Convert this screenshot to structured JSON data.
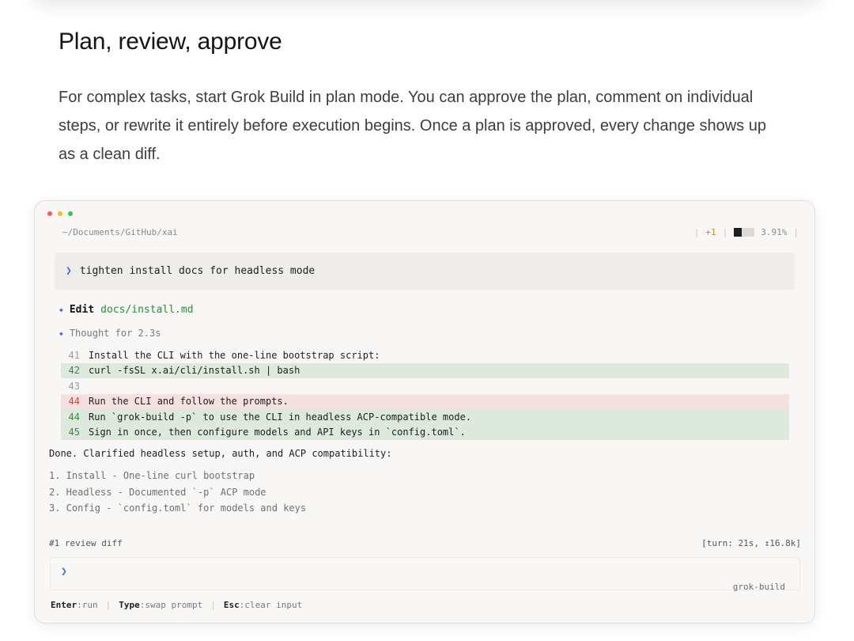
{
  "section": {
    "title": "Plan, review, approve",
    "description": "For complex tasks, start Grok Build in plan mode. You can approve the plan, comment on individual steps, or rewrite it entirely before execution begins. Once a plan is approved, every change shows up as a clean diff."
  },
  "terminal": {
    "path": "~/Documents/GitHub/xai",
    "status": {
      "added": "+1",
      "usage_percent": "3.91%",
      "usage_fraction": 0.391
    },
    "prompt": {
      "chevron": "❯",
      "text": "tighten install docs for headless mode"
    },
    "edit": {
      "label": "Edit",
      "file": "docs/install.md"
    },
    "thought": "Thought for 2.3s",
    "diff": [
      {
        "num": "41",
        "type": "ctx",
        "text": "Install the CLI with the one-line bootstrap script:"
      },
      {
        "num": "42",
        "type": "add",
        "text": "curl -fsSL x.ai/cli/install.sh | bash"
      },
      {
        "num": "43",
        "type": "ctx",
        "text": ""
      },
      {
        "num": "44",
        "type": "del",
        "text": "Run the CLI and follow the prompts."
      },
      {
        "num": "44",
        "type": "add",
        "text": "Run `grok-build -p` to use the CLI in headless ACP-compatible mode."
      },
      {
        "num": "45",
        "type": "add",
        "text": "Sign in once, then configure models and API keys in `config.toml`."
      }
    ],
    "done": "Done. Clarified headless setup, auth, and ACP compatibility:",
    "summary": [
      "1. Install - One-line curl bootstrap",
      "2. Headless - Documented `-p` ACP mode",
      "3. Config - `config.toml` for models and keys"
    ],
    "review_tag": "#1 review diff",
    "turn_info": "[turn: 21s, ↕16.8k]",
    "input": {
      "chevron": "❯",
      "value": "",
      "placeholder": ""
    },
    "agent_name": "grok-build",
    "hints": [
      {
        "key": "Enter",
        "action": ":run"
      },
      {
        "key": "Type",
        "action": ":swap prompt"
      },
      {
        "key": "Esc",
        "action": ":clear input"
      }
    ]
  }
}
